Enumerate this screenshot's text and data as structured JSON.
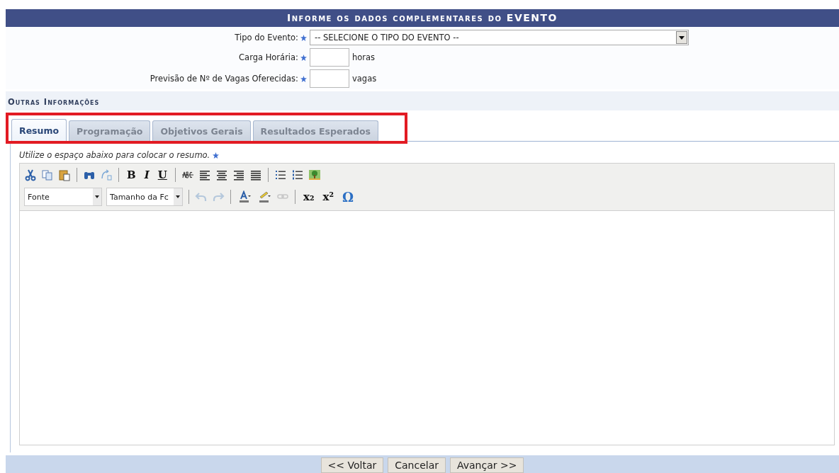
{
  "header": {
    "title": "Informe os dados complementares do EVENTO"
  },
  "fields": [
    {
      "kind": "select",
      "label": "Tipo do Evento:",
      "required": true,
      "value": "-- SELECIONE O TIPO DO EVENTO --"
    },
    {
      "kind": "text",
      "label": "Carga Horária:",
      "required": true,
      "unit": "horas"
    },
    {
      "kind": "text",
      "label": "Previsão de Nº de Vagas Oferecidas:",
      "required": true,
      "unit": "vagas"
    }
  ],
  "section": {
    "title": "Outras Informações"
  },
  "tabs": [
    {
      "label": "Resumo",
      "selected": true
    },
    {
      "label": "Programação",
      "selected": false
    },
    {
      "label": "Objetivos Gerais",
      "selected": false
    },
    {
      "label": "Resultados Esperados",
      "selected": false
    }
  ],
  "instruction": {
    "text": "Utilize o espaço abaixo para colocar o resumo.",
    "required": true
  },
  "toolbar": {
    "bold": "B",
    "italic": "I",
    "underline": "U",
    "font": "Fonte",
    "font_size": "Tamanho da Fc",
    "subscript": "x₂",
    "superscript": "x²",
    "special": "Ω",
    "history": [
      {
        "kind": "undo",
        "disabled": true
      },
      {
        "kind": "redo",
        "disabled": true
      }
    ],
    "link": {
      "disabled": true
    }
  },
  "buttons": [
    "<< Voltar",
    "Cancelar",
    "Avançar >>"
  ]
}
